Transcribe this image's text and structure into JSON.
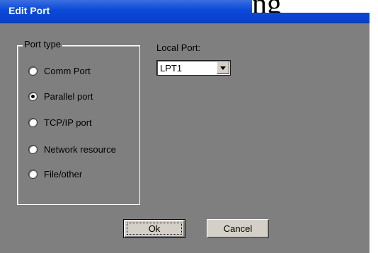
{
  "window": {
    "title": "Edit Port",
    "title_overflow_text": "ng"
  },
  "port_type": {
    "group_label": "Port type",
    "options": [
      {
        "label": "Comm Port",
        "checked": false
      },
      {
        "label": "Parallel port",
        "checked": true
      },
      {
        "label": "TCP/IP port",
        "checked": false
      },
      {
        "label": "Network resource",
        "checked": false
      },
      {
        "label": "File/other",
        "checked": false
      }
    ]
  },
  "local_port": {
    "label": "Local Port:",
    "value": "LPT1"
  },
  "buttons": {
    "ok": "Ok",
    "cancel": "Cancel"
  },
  "colors": {
    "title_bar": "#0a49d8",
    "dialog_bg": "#7f7f7f",
    "button_face": "#d4d0c8"
  }
}
